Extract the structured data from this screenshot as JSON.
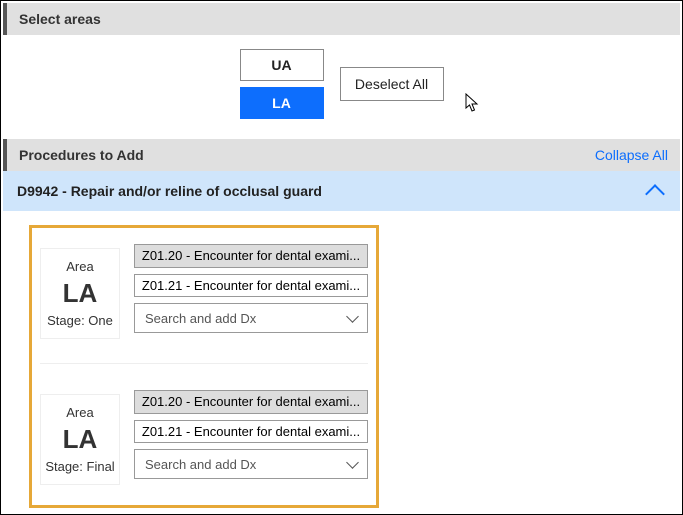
{
  "select_areas": {
    "title": "Select areas",
    "options": {
      "ua": "UA",
      "la": "LA"
    },
    "deselect": "Deselect All"
  },
  "procedures": {
    "title": "Procedures to Add",
    "collapse": "Collapse All",
    "item": {
      "label": "D9942 - Repair and/or reline of occlusal guard"
    }
  },
  "stages": [
    {
      "area_label": "Area",
      "area_code": "LA",
      "stage_label": "Stage: One",
      "dx_primary": "Z01.20 - Encounter for dental exami...",
      "dx_secondary": "Z01.21 - Encounter for dental exami...",
      "search_placeholder": "Search and add Dx"
    },
    {
      "area_label": "Area",
      "area_code": "LA",
      "stage_label": "Stage: Final",
      "dx_primary": "Z01.20 - Encounter for dental exami...",
      "dx_secondary": "Z01.21 - Encounter for dental exami...",
      "search_placeholder": "Search and add Dx"
    }
  ]
}
